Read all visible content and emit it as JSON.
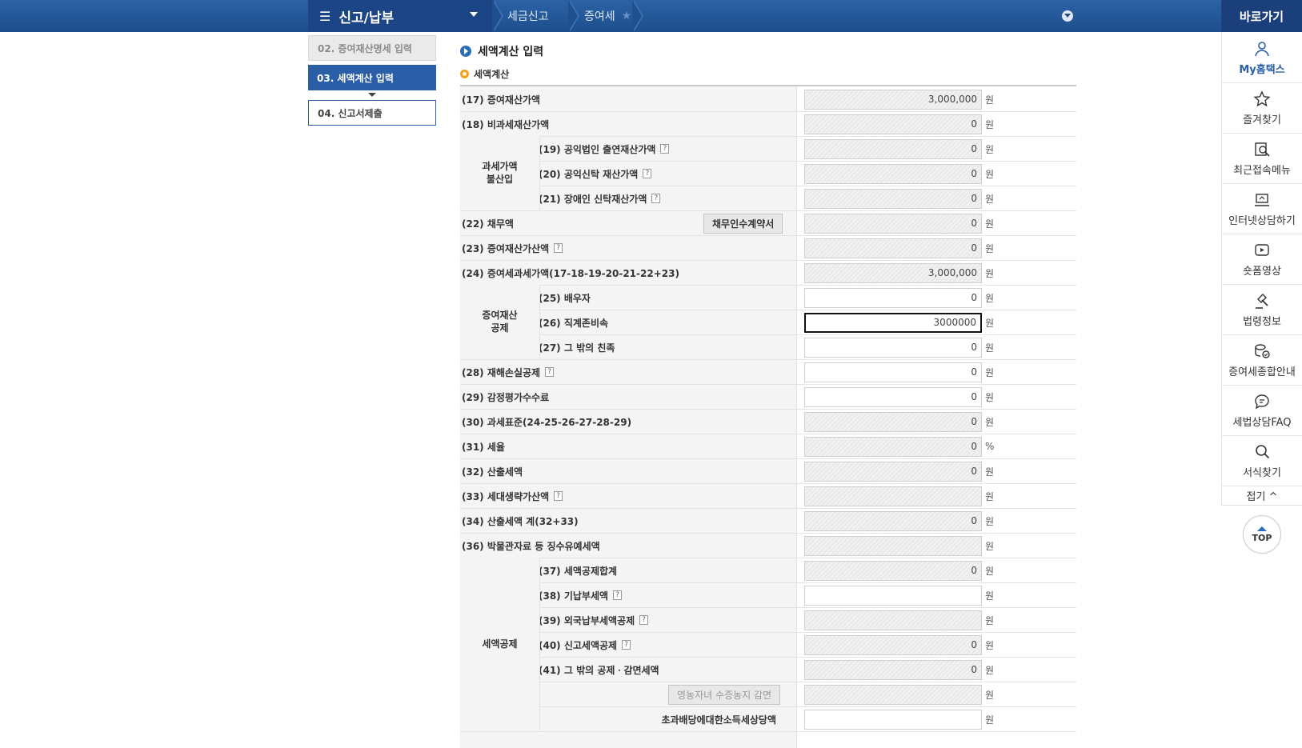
{
  "header": {
    "menu_title": "신고/납부",
    "breadcrumbs": [
      "세금신고",
      "증여세"
    ],
    "shortcut_title": "바로가기"
  },
  "steps": [
    {
      "label": "02. 증여재산명세 입력",
      "state": "done"
    },
    {
      "label": "03. 세액계산 입력",
      "state": "active"
    },
    {
      "label": "04. 신고서제출",
      "state": "next"
    }
  ],
  "section": {
    "title": "세액계산 입력",
    "subtitle": "세액계산"
  },
  "groups": {
    "g1": "과세가액\n불산입",
    "g2": "증여재산\n공제",
    "g3": "세액공제"
  },
  "buttons": {
    "debt_contract": "채무인수계약서",
    "farmer_reduction": "영농자녀 수증농지 감면"
  },
  "rows": [
    {
      "label": "(17) 증여재산가액",
      "help": false,
      "value": "3,000,000",
      "unit": "원"
    },
    {
      "label": "(18) 비과세재산가액",
      "help": false,
      "value": "0",
      "unit": "원"
    },
    {
      "label": "(19) 공익법인 출연재산가액",
      "help": true,
      "value": "0",
      "unit": "원"
    },
    {
      "label": "(20) 공익신탁 재산가액",
      "help": true,
      "value": "0",
      "unit": "원"
    },
    {
      "label": "(21) 장애인 신탁재산가액",
      "help": true,
      "value": "0",
      "unit": "원"
    },
    {
      "label": "(22) 채무액",
      "help": false,
      "value": "0",
      "unit": "원"
    },
    {
      "label": "(23) 증여재산가산액",
      "help": true,
      "value": "0",
      "unit": "원"
    },
    {
      "label": "(24) 증여세과세가액(17-18-19-20-21-22+23)",
      "help": false,
      "value": "3,000,000",
      "unit": "원"
    },
    {
      "label": "(25) 배우자",
      "help": false,
      "value": "0",
      "unit": "원"
    },
    {
      "label": "(26) 직계존비속",
      "help": false,
      "value": "3000000",
      "unit": "원"
    },
    {
      "label": "(27) 그 밖의 친족",
      "help": false,
      "value": "0",
      "unit": "원"
    },
    {
      "label": "(28) 재해손실공제",
      "help": true,
      "value": "0",
      "unit": "원"
    },
    {
      "label": "(29) 감정평가수수료",
      "help": false,
      "value": "0",
      "unit": "원"
    },
    {
      "label": "(30) 과세표준(24-25-26-27-28-29)",
      "help": false,
      "value": "0",
      "unit": "원"
    },
    {
      "label": "(31) 세율",
      "help": false,
      "value": "0",
      "unit": "%"
    },
    {
      "label": "(32) 산출세액",
      "help": false,
      "value": "0",
      "unit": "원"
    },
    {
      "label": "(33) 세대생략가산액",
      "help": true,
      "value": "",
      "unit": "원"
    },
    {
      "label": "(34) 산출세액 계(32+33)",
      "help": false,
      "value": "0",
      "unit": "원"
    },
    {
      "label": "(36) 박물관자료 등 징수유예세액",
      "help": false,
      "value": "",
      "unit": "원"
    },
    {
      "label": "(37) 세액공제합계",
      "help": false,
      "value": "0",
      "unit": "원"
    },
    {
      "label": "(38) 기납부세액",
      "help": true,
      "value": "",
      "unit": "원"
    },
    {
      "label": "(39) 외국납부세액공제",
      "help": true,
      "value": "",
      "unit": "원"
    },
    {
      "label": "(40) 신고세액공제",
      "help": true,
      "value": "0",
      "unit": "원"
    },
    {
      "label": "(41) 그 밖의 공제ㆍ감면세액",
      "help": false,
      "value": "0",
      "unit": "원"
    },
    {
      "label": "",
      "help": false,
      "value": "",
      "unit": "원"
    },
    {
      "label": "초과배당에대한소득세상당액",
      "help": false,
      "value": "",
      "unit": "원"
    }
  ],
  "help_mark": "?",
  "quick_menu": [
    {
      "label": "My홈택스",
      "icon": "person-icon"
    },
    {
      "label": "즐겨찾기",
      "icon": "star-icon"
    },
    {
      "label": "최근접속메뉴",
      "icon": "recent-search-icon"
    },
    {
      "label": "인터넷상담하기",
      "icon": "laptop-icon"
    },
    {
      "label": "숏폼영상",
      "icon": "play-icon"
    },
    {
      "label": "법령정보",
      "icon": "gavel-icon"
    },
    {
      "label": "증여세종합안내",
      "icon": "coins-check-icon"
    },
    {
      "label": "세법상담FAQ",
      "icon": "chat-icon"
    },
    {
      "label": "서식찾기",
      "icon": "search-icon"
    }
  ],
  "fold_label": "접기 ^",
  "top_label": "TOP",
  "colors": {
    "brand": "#1e4e8c",
    "active_step": "#2a5ea6",
    "accent_dot": "#f2a11c"
  }
}
